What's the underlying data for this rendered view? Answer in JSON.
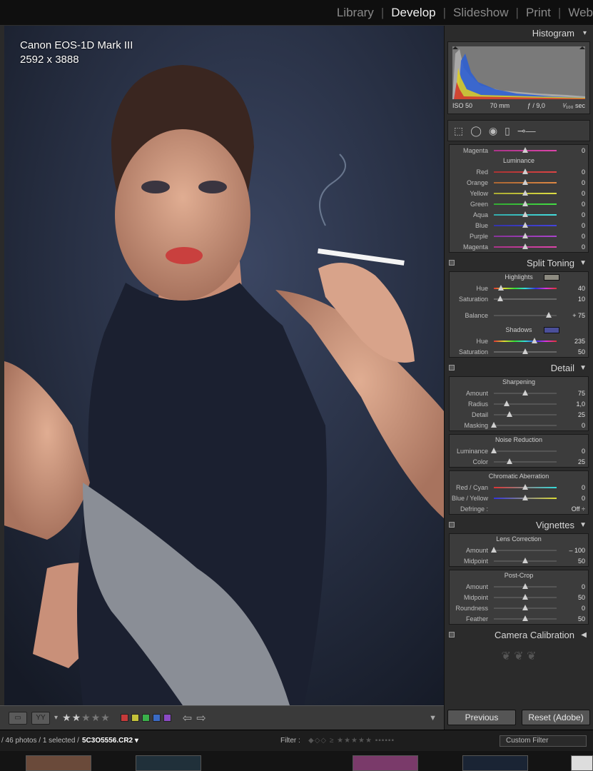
{
  "modules": [
    "Library",
    "Develop",
    "Slideshow",
    "Print",
    "Web"
  ],
  "active_module": "Develop",
  "photo_info": {
    "camera": "Canon EOS-1D Mark III",
    "dimensions": "2592 x 3888"
  },
  "histogram": {
    "title": "Histogram",
    "iso": "ISO 50",
    "focal": "70 mm",
    "aperture": "ƒ / 9,0",
    "shutter": "¹⁄₁₀₀ sec"
  },
  "hsl": {
    "top_row": {
      "label": "Magenta",
      "value": "0",
      "pos": 0.5
    },
    "section_title": "Luminance",
    "rows": [
      {
        "label": "Red",
        "value": "0",
        "pos": 0.5
      },
      {
        "label": "Orange",
        "value": "0",
        "pos": 0.5
      },
      {
        "label": "Yellow",
        "value": "0",
        "pos": 0.5
      },
      {
        "label": "Green",
        "value": "0",
        "pos": 0.5
      },
      {
        "label": "Aqua",
        "value": "0",
        "pos": 0.5
      },
      {
        "label": "Blue",
        "value": "0",
        "pos": 0.5
      },
      {
        "label": "Purple",
        "value": "0",
        "pos": 0.5
      },
      {
        "label": "Magenta",
        "value": "0",
        "pos": 0.5
      }
    ]
  },
  "split_toning": {
    "title": "Split Toning",
    "highlights_title": "Highlights",
    "highlights_color": "#8c8a80",
    "highlights": [
      {
        "label": "Hue",
        "value": "40",
        "pos": 0.11
      },
      {
        "label": "Saturation",
        "value": "10",
        "pos": 0.1
      }
    ],
    "balance": {
      "label": "Balance",
      "value": "+ 75",
      "pos": 0.875
    },
    "shadows_title": "Shadows",
    "shadows_color": "#4b4f9a",
    "shadows": [
      {
        "label": "Hue",
        "value": "235",
        "pos": 0.65
      },
      {
        "label": "Saturation",
        "value": "50",
        "pos": 0.5
      }
    ]
  },
  "detail": {
    "title": "Detail",
    "sharpening_title": "Sharpening",
    "sharpening": [
      {
        "label": "Amount",
        "value": "75",
        "pos": 0.5
      },
      {
        "label": "Radius",
        "value": "1,0",
        "pos": 0.2
      },
      {
        "label": "Detail",
        "value": "25",
        "pos": 0.25
      },
      {
        "label": "Masking",
        "value": "0",
        "pos": 0.0
      }
    ],
    "noise_title": "Noise Reduction",
    "noise": [
      {
        "label": "Luminance",
        "value": "0",
        "pos": 0.0
      },
      {
        "label": "Color",
        "value": "25",
        "pos": 0.25
      }
    ],
    "ca_title": "Chromatic Aberration",
    "ca": [
      {
        "label": "Red / Cyan",
        "value": "0",
        "pos": 0.5
      },
      {
        "label": "Blue / Yellow",
        "value": "0",
        "pos": 0.5
      }
    ],
    "defringe_label": "Defringe :",
    "defringe_value": "Off ÷"
  },
  "vignettes": {
    "title": "Vignettes",
    "lens_title": "Lens Correction",
    "lens": [
      {
        "label": "Amount",
        "value": "– 100",
        "pos": 0.0
      },
      {
        "label": "Midpoint",
        "value": "50",
        "pos": 0.5
      }
    ],
    "postcrop_title": "Post-Crop",
    "postcrop": [
      {
        "label": "Amount",
        "value": "0",
        "pos": 0.5
      },
      {
        "label": "Midpoint",
        "value": "50",
        "pos": 0.5
      },
      {
        "label": "Roundness",
        "value": "0",
        "pos": 0.5
      },
      {
        "label": "Feather",
        "value": "50",
        "pos": 0.5
      }
    ]
  },
  "camera_calibration": {
    "title": "Camera Calibration"
  },
  "buttons": {
    "previous": "Previous",
    "reset": "Reset (Adobe)"
  },
  "filmbar": {
    "count": "/ 46 photos / 1 selected /",
    "filename": "5C3O5556.CR2 ▾",
    "filter_label": "Filter :",
    "custom_filter": "Custom Filter"
  },
  "toolbar": {
    "rating": 2,
    "color_labels": [
      "#c43a3a",
      "#c4c23a",
      "#3ab04a",
      "#3a6ac4",
      "#8a4ac4"
    ]
  }
}
